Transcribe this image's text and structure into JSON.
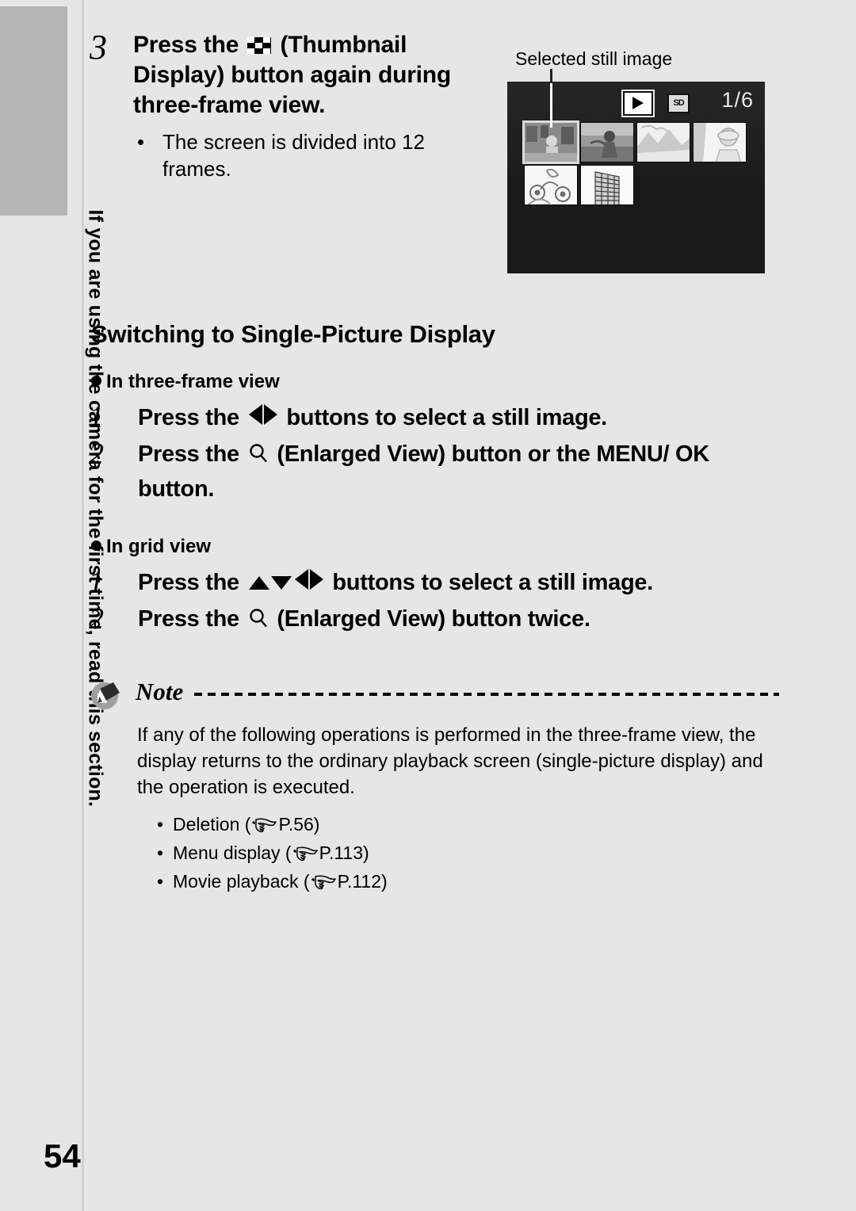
{
  "page": {
    "number": "54",
    "background": "#e6e6e6",
    "side_tab_color": "#b5b5b5",
    "vertical_text": "If you are using the camera for the first time, read this section."
  },
  "step3": {
    "number": "3",
    "text_before_icon": "Press the ",
    "icon": "thumbnail-display-icon",
    "text_after_icon": " (Thumbnail Display) button again during three-frame view.",
    "bullet_marker": "•",
    "bullet_text": "The screen is divided into 12 frames."
  },
  "lcd": {
    "callout": "Selected still image",
    "play_icon": "playback-mode-icon",
    "card_icon": "SD",
    "frame_count": "1/6",
    "thumbnails": [
      {
        "id": 1,
        "selected": true,
        "scene": "indoor-people"
      },
      {
        "id": 2,
        "selected": false,
        "scene": "beach-person"
      },
      {
        "id": 3,
        "selected": false,
        "scene": "mountain-landscape"
      },
      {
        "id": 4,
        "selected": false,
        "scene": "portrait-woman"
      },
      {
        "id": 5,
        "selected": false,
        "scene": "sunflowers"
      },
      {
        "id": 6,
        "selected": false,
        "scene": "building"
      }
    ]
  },
  "section": {
    "heading": "Switching to Single-Picture Display"
  },
  "three_frame": {
    "bullet_label": "In three-frame view",
    "steps": [
      {
        "number": "1",
        "pre": "Press the ",
        "icon": "left-right-arrow-buttons-icon",
        "post": " buttons to select a still image."
      },
      {
        "number": "2",
        "pre": "Press the ",
        "icon": "enlarged-view-magnifier-icon",
        "post": " (Enlarged View) button or the MENU/ OK button."
      }
    ]
  },
  "grid_view": {
    "bullet_label": "In grid view",
    "steps": [
      {
        "number": "1",
        "pre": "Press the ",
        "icon": "four-way-arrow-buttons-icon",
        "post": " buttons to select a still image."
      },
      {
        "number": "2",
        "pre": "Press the ",
        "icon": "enlarged-view-magnifier-icon",
        "post": " (Enlarged View) button twice."
      }
    ]
  },
  "note": {
    "label": "Note",
    "body": "If any of the following operations is performed in the three-frame view, the display returns to the ordinary playback screen (single-picture display) and the operation is executed.",
    "items": [
      {
        "bullet": "•",
        "text": "Deletion (",
        "ref": "P.56",
        "close": ")"
      },
      {
        "bullet": "•",
        "text": "Menu display (",
        "ref": "P.113",
        "close": ")"
      },
      {
        "bullet": "•",
        "text": "Movie playback (",
        "ref": "P.112",
        "close": ")"
      }
    ]
  }
}
